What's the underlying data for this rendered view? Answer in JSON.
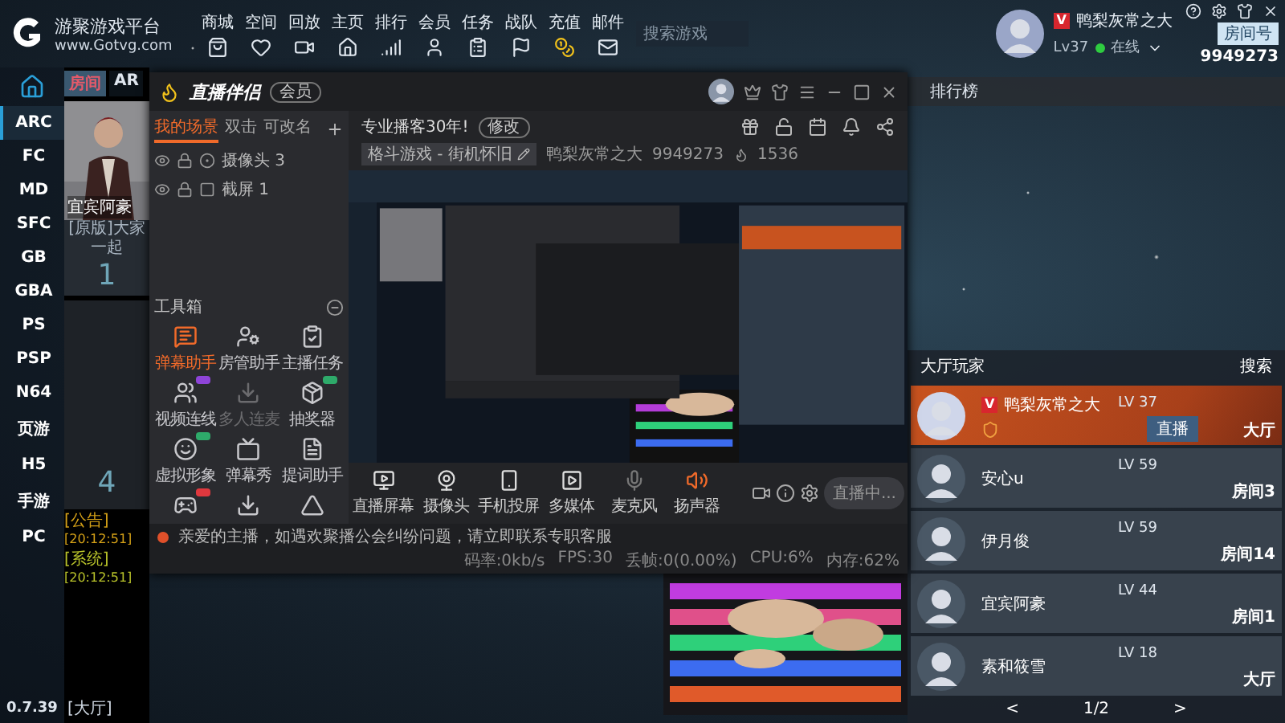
{
  "top_bar": {
    "logo_title": "游聚游戏平台",
    "logo_url": "www.Gotvg.com",
    "nav": [
      {
        "label": "商城"
      },
      {
        "label": "空间"
      },
      {
        "label": "回放"
      },
      {
        "label": "主页"
      },
      {
        "label": "排行"
      },
      {
        "label": "会员"
      },
      {
        "label": "任务"
      },
      {
        "label": "战队"
      },
      {
        "label": "充值"
      },
      {
        "label": "邮件"
      }
    ],
    "search": {
      "placeholder": "搜索游戏"
    }
  },
  "user": {
    "vip": "V",
    "name": "鸭梨灰常之大",
    "level": "Lv37",
    "status": "在线",
    "room_label": "房间号",
    "room_number": "9949273"
  },
  "sidebar": {
    "items": [
      {
        "label": "ARC",
        "selected": true
      },
      {
        "label": "FC",
        "selected": false
      },
      {
        "label": "MD",
        "selected": false
      },
      {
        "label": "SFC",
        "selected": false
      },
      {
        "label": "GB",
        "selected": false
      },
      {
        "label": "GBA",
        "selected": false
      },
      {
        "label": "PS",
        "selected": false
      },
      {
        "label": "PSP",
        "selected": false
      },
      {
        "label": "N64",
        "selected": false
      },
      {
        "label": "页游",
        "selected": false
      },
      {
        "label": "H5",
        "selected": false
      },
      {
        "label": "手游",
        "selected": false
      },
      {
        "label": "PC",
        "selected": false
      }
    ],
    "version": "0.7.39"
  },
  "lobby": {
    "tabs": [
      {
        "label": "房间",
        "selected": true
      },
      {
        "label": "AR",
        "selected": false
      }
    ],
    "rooms": [
      {
        "kind": "picture",
        "host": "宜宾阿豪",
        "title": "[原版]大家一起",
        "number": "1"
      },
      {
        "kind": "empty",
        "number": "4"
      }
    ],
    "chat": [
      {
        "tag": "[公告]",
        "time": "[20:12:51]",
        "color": "#d4a017"
      },
      {
        "tag": "[系统]",
        "time": "[20:12:51]",
        "color": "#b8c22a"
      }
    ],
    "channel": "[大厅]"
  },
  "stream_window": {
    "logo": "直播伴侣",
    "member": "会员",
    "scene_tabs": [
      {
        "label": "我的场景",
        "selected": true
      },
      {
        "label": "双击",
        "selected": false
      },
      {
        "label": "可改名",
        "selected": false
      }
    ],
    "sources": [
      {
        "label": "摄像头 3",
        "kind": "camera"
      },
      {
        "label": "截屏 1",
        "kind": "screen"
      }
    ],
    "toolbox": {
      "title": "工具箱",
      "tools": [
        {
          "kind": "tool",
          "label": "弹幕助手",
          "active": true,
          "disabled": false
        },
        {
          "kind": "tool",
          "label": "房管助手",
          "active": false,
          "disabled": false
        },
        {
          "kind": "tool",
          "label": "主播任务",
          "active": false,
          "disabled": false
        },
        {
          "kind": "tool",
          "label": "视频连线",
          "active": false,
          "disabled": false,
          "color": "#8e44d8"
        },
        {
          "kind": "tool",
          "label": "多人连麦",
          "active": false,
          "disabled": true
        },
        {
          "kind": "tool",
          "label": "抽奖器",
          "active": false,
          "disabled": false,
          "color": "#2eaa6a"
        },
        {
          "kind": "tool",
          "label": "虚拟形象",
          "active": false,
          "disabled": false,
          "color": "#2eaa6a"
        },
        {
          "kind": "tool",
          "label": "弹幕秀",
          "active": false,
          "disabled": false
        },
        {
          "kind": "tool",
          "label": "提词助手",
          "active": false,
          "disabled": false
        },
        {
          "kind": "icon",
          "active": false,
          "disabled": false,
          "color": "#e0383e"
        },
        {
          "kind": "icon",
          "active": false,
          "disabled": false
        },
        {
          "kind": "icon",
          "active": false,
          "disabled": false
        }
      ]
    },
    "title": "专业播客30年!",
    "edit": "修改",
    "category": "格斗游戏 - 街机怀旧",
    "streamer": "鸭梨灰常之大",
    "room_number": "9949273",
    "popularity": "1536",
    "capture_buttons": [
      {
        "label": "直播屏幕"
      },
      {
        "label": "摄像头"
      },
      {
        "label": "手机投屏"
      },
      {
        "label": "多媒体"
      }
    ],
    "audio_buttons": [
      {
        "label": "麦克风",
        "on": false
      },
      {
        "label": "扬声器",
        "on": true
      }
    ],
    "live_button": "直播中...",
    "notice": "亲爱的主播，如遇欢聚播公会纠纷问题，请立即联系专职客服",
    "stats": [
      "码率:0kb/s",
      "FPS:30",
      "丢帧:0(0.00%)",
      "CPU:6%",
      "内存:62%"
    ]
  },
  "ranking": {
    "title": "排行榜"
  },
  "players_panel": {
    "title": "大厅玩家",
    "search": "搜索",
    "players": [
      {
        "name": "鸭梨灰常之大",
        "level": "LV 37",
        "location": "大厅",
        "vip_badge": "V",
        "selected": true,
        "live": "直播"
      },
      {
        "name": "安心u",
        "level": "LV 59",
        "location": "房间3",
        "selected": false
      },
      {
        "name": "伊月俊",
        "level": "LV 59",
        "location": "房间14",
        "selected": false
      },
      {
        "name": "宜宾阿豪",
        "level": "LV 44",
        "location": "房间1",
        "selected": false
      },
      {
        "name": "素和筱雪",
        "level": "LV 18",
        "location": "大厅",
        "selected": false
      }
    ],
    "prev": "<",
    "page": "1/2",
    "next": ">"
  }
}
